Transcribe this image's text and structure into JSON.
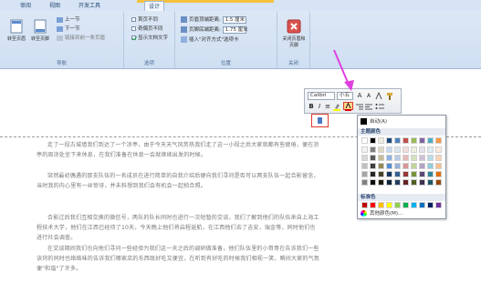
{
  "tabs": [
    {
      "label": "审阅"
    },
    {
      "label": "视图"
    },
    {
      "label": "开发工具"
    },
    {
      "label": "设计"
    }
  ],
  "ribbon": {
    "nav": {
      "goto_header": "转至页眉",
      "goto_footer": "转至页脚",
      "previous": "上一节",
      "next": "下一节",
      "link_previous": "链接到前一条页眉",
      "label": "导航"
    },
    "options": {
      "different_first": "首页不同",
      "different_odd_even": "奇偶页不同",
      "show_doc_text": "显示文档文字",
      "label": "选项"
    },
    "position": {
      "header_from_top": "页眉顶端距离:",
      "header_value": "1.5 厘米",
      "footer_from_bottom": "页脚底端距离:",
      "footer_value": "1.75 厘米",
      "insert_align_tab": "插入\"对齐方式\"选项卡",
      "label": "位置"
    },
    "close": {
      "button": "关闭页眉和页脚",
      "label": "关闭"
    }
  },
  "document": {
    "paragraphs": [
      "走了一段古城墙我们到达了一个凉亭，由于今天天气风势热我们走了这一小段之后大家就都有些疲倦，便在凉亭的周凉处坐下来休息，在我们准备在休息一会就继续出发的时候。",
      "突然最初偶遇的那支队伍的一名成员在进行简单的自我介绍后便向我们寻问是否可以两支队伍一起合影留念，当时我的内心里有一丝惊讶，并未料想到我们会有机会一起拍合照。",
      "合影过后我们互相交换的微信号，两队的队长同时也进行一次短暂的交谈，我们了解到他们的队伍来自上海工程技术大学，他们在江西已经待了10天，今天晚上他们将启程返航，在江西他们去了吉安，瑞金等，同时他们也进行社会调查。",
      "在交谈期间我们也向他们寻问一些经验为我们这一天之后的调研做准备，他们队伍里的小哥哥在告诉我们一些诀窍的同时也络络味的告诉我们哪家店的东西既好吃又便宜，在听到有好吃的时候我们相视一笑，瞬间大家的气氛便\"和谐\"了许多。"
    ]
  },
  "minitoolbar": {
    "font": "Calibri",
    "size": "小五",
    "grow": "A",
    "shrink": "A",
    "bold": "B",
    "italic": "I",
    "align_center": "≡"
  },
  "colorpanel": {
    "automatic": "自动(A)",
    "theme_colors": "主题颜色",
    "standard_colors": "标准色",
    "more_colors": "其他颜色(M)...",
    "theme_top": [
      "#ffffff",
      "#000000",
      "#eeece1",
      "#1f497d",
      "#4f81bd",
      "#c0504d",
      "#9bbb59",
      "#8064a2",
      "#4bacc6",
      "#f79646"
    ],
    "theme_shades": [
      [
        "#f2f2f2",
        "#7f7f7f",
        "#ddd9c3",
        "#c6d9f0",
        "#dbe5f1",
        "#f2dcdb",
        "#ebf1dd",
        "#e5e0ec",
        "#dbeef3",
        "#fdeada"
      ],
      [
        "#d8d8d8",
        "#595959",
        "#c4bd97",
        "#8db3e2",
        "#b8cce4",
        "#e5b9b7",
        "#d7e3bc",
        "#ccc1d9",
        "#b7dde8",
        "#fbd5b5"
      ],
      [
        "#bfbfbf",
        "#3f3f3f",
        "#938953",
        "#548dd4",
        "#95b3d7",
        "#d99694",
        "#c3d69b",
        "#b2a2c7",
        "#92cddc",
        "#fac08f"
      ],
      [
        "#a5a5a5",
        "#262626",
        "#494429",
        "#17365d",
        "#366092",
        "#953734",
        "#76923c",
        "#5f497a",
        "#31859b",
        "#e36c09"
      ],
      [
        "#7f7f7f",
        "#0c0c0c",
        "#1d1b10",
        "#0f243e",
        "#244061",
        "#632423",
        "#4f6128",
        "#3f3151",
        "#205867",
        "#974806"
      ]
    ],
    "standard": [
      "#c00000",
      "#ff0000",
      "#ffc000",
      "#ffff00",
      "#92d050",
      "#00b050",
      "#00b0f0",
      "#0070c0",
      "#002060",
      "#7030a0"
    ]
  },
  "accent": {
    "arrow": "#e040e0",
    "highlight": "#e0392b"
  }
}
